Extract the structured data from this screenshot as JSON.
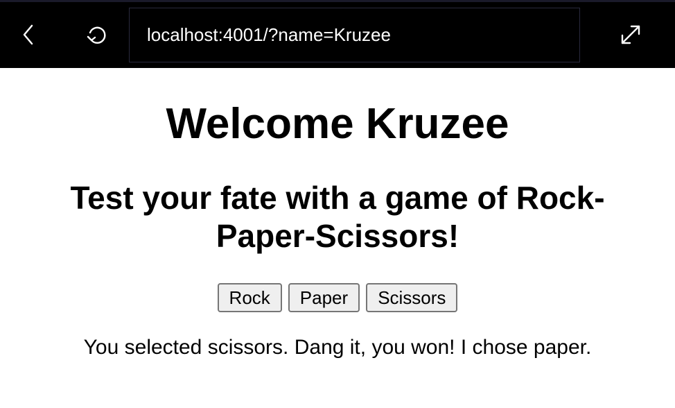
{
  "browser": {
    "url": "localhost:4001/?name=Kruzee",
    "back_icon": "chevron-left-icon",
    "reload_icon": "reload-icon",
    "expand_icon": "expand-icon"
  },
  "page": {
    "title": "Welcome Kruzee",
    "subtitle": "Test your fate with a game of Rock-Paper-Scissors!",
    "buttons": [
      "Rock",
      "Paper",
      "Scissors"
    ],
    "result": "You selected scissors. Dang it, you won! I chose paper."
  }
}
